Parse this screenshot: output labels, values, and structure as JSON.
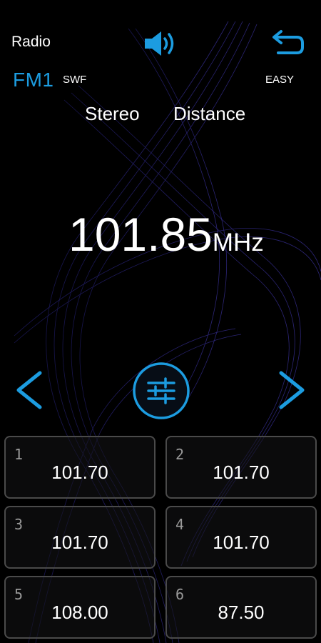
{
  "header": {
    "title": "Radio",
    "speaker_icon": "speaker-volume-icon",
    "back_icon": "return-arrow-icon"
  },
  "status": {
    "band": "FM1",
    "swf": "SWF",
    "easy": "EASY",
    "stereo": "Stereo",
    "distance": "Distance"
  },
  "tuner": {
    "frequency": "101.85",
    "unit": "MHz"
  },
  "controls": {
    "prev_icon": "chevron-left-icon",
    "next_icon": "chevron-right-icon",
    "eq_icon": "sliders-icon"
  },
  "presets": [
    {
      "index": "1",
      "value": "101.70"
    },
    {
      "index": "2",
      "value": "101.70"
    },
    {
      "index": "3",
      "value": "101.70"
    },
    {
      "index": "4",
      "value": "101.70"
    },
    {
      "index": "5",
      "value": "108.00"
    },
    {
      "index": "6",
      "value": "87.50"
    }
  ],
  "colors": {
    "accent": "#1c9ce0",
    "background": "#000000",
    "wave": "#4a3fd8",
    "preset_border": "#4a4a4a"
  }
}
